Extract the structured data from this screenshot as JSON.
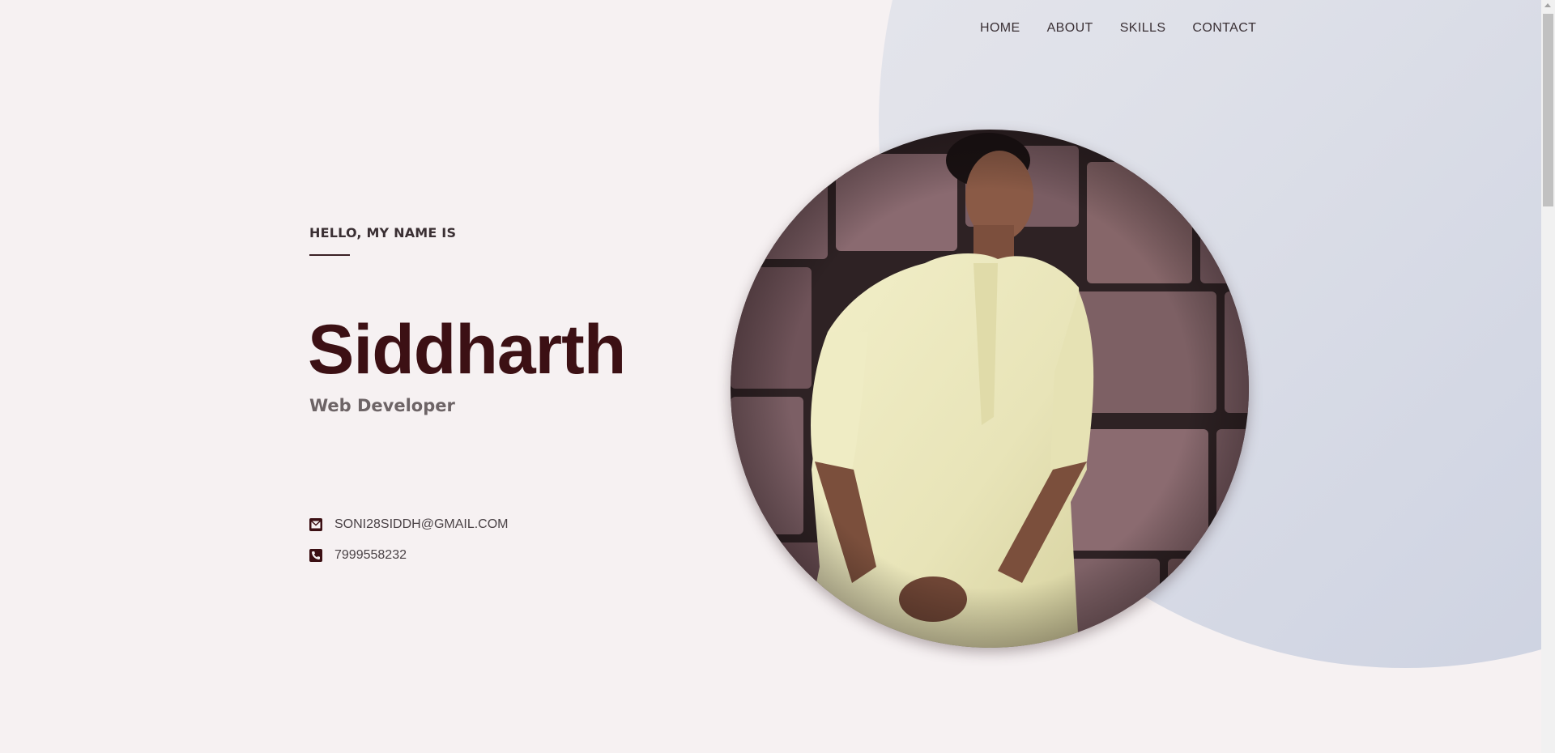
{
  "nav": {
    "items": [
      "HOME",
      "ABOUT",
      "SKILLS",
      "CONTACT"
    ]
  },
  "hero": {
    "greeting": "HELLO, MY NAME IS",
    "name": "Siddharth",
    "role": "Web Developer"
  },
  "contact": {
    "email": "SONI28SIDDH@GMAIL.COM",
    "phone": "7999558232"
  },
  "colors": {
    "background": "#f6f1f2",
    "name": "#3c1014",
    "accent_blob": "#c8cedf"
  },
  "icons": {
    "email": "envelope-icon",
    "phone": "phone-icon"
  }
}
